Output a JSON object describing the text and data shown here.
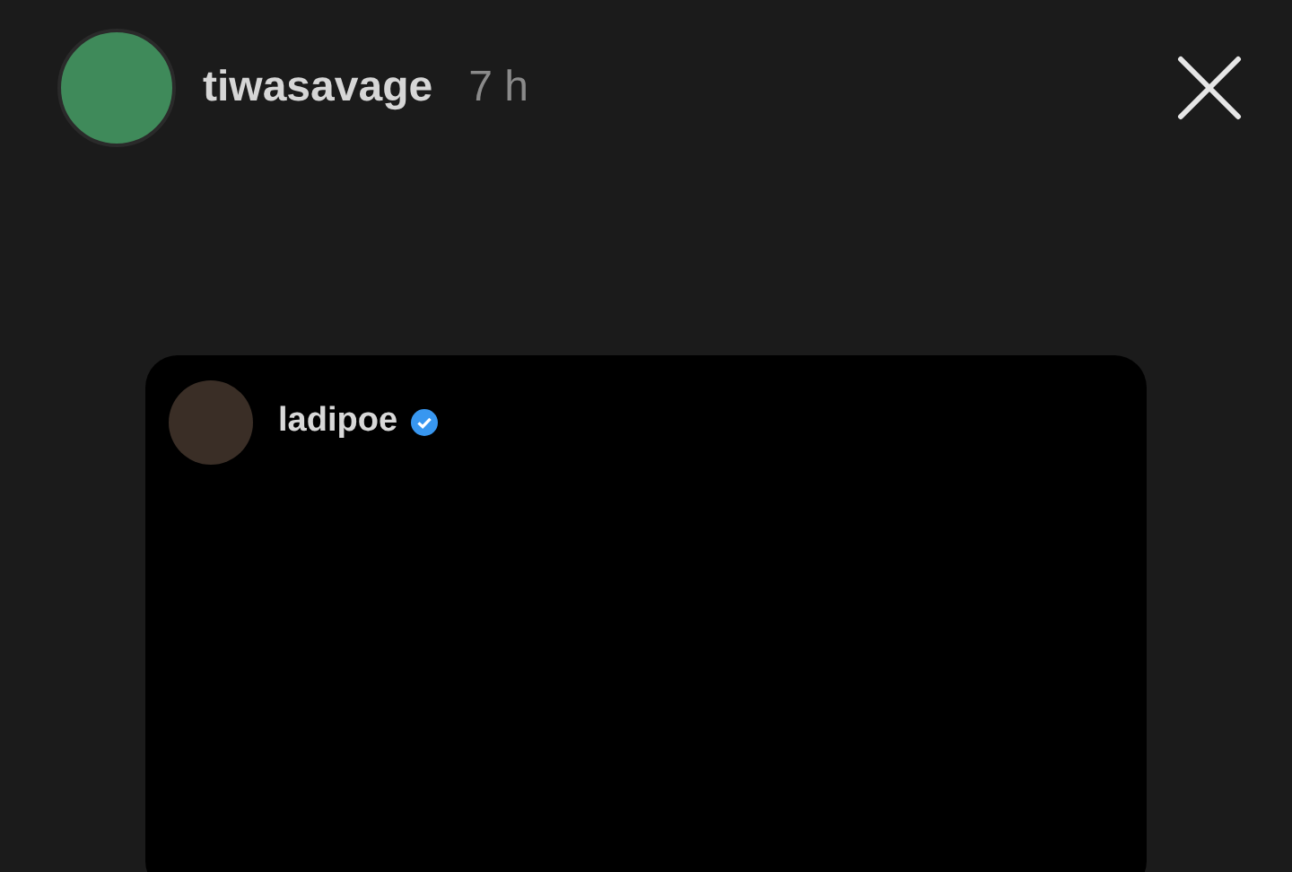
{
  "story_header": {
    "username": "tiwasavage",
    "time": "7 h"
  },
  "shared_post": {
    "username": "ladipoe",
    "verified": true
  }
}
